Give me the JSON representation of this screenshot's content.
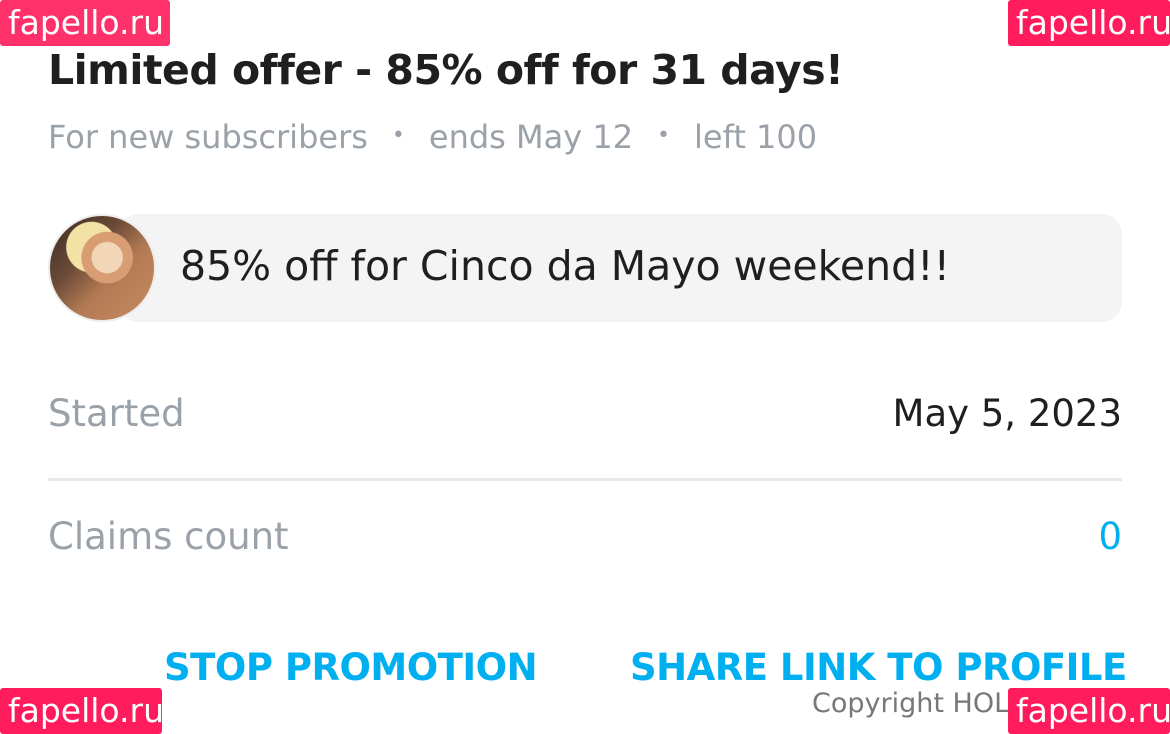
{
  "offer": {
    "title": "Limited offer - 85% off for 31 days!",
    "audience": "For new subscribers",
    "ends": "ends May 12",
    "left": "left 100",
    "separator": "•",
    "message": "85% off for Cinco da Mayo weekend!!"
  },
  "details": {
    "started_label": "Started",
    "started_value": "May 5, 2023",
    "claims_label": "Claims count",
    "claims_value": "0"
  },
  "actions": {
    "stop_label": "STOP PROMOTION",
    "share_label": "SHARE LINK TO PROFILE"
  },
  "footer": {
    "copyright": "Copyright HOL"
  },
  "watermark": {
    "text": "fapello.ru",
    "color": "#ff1b5c"
  },
  "colors": {
    "accent": "#00aff0",
    "muted": "#9aa1a8"
  }
}
